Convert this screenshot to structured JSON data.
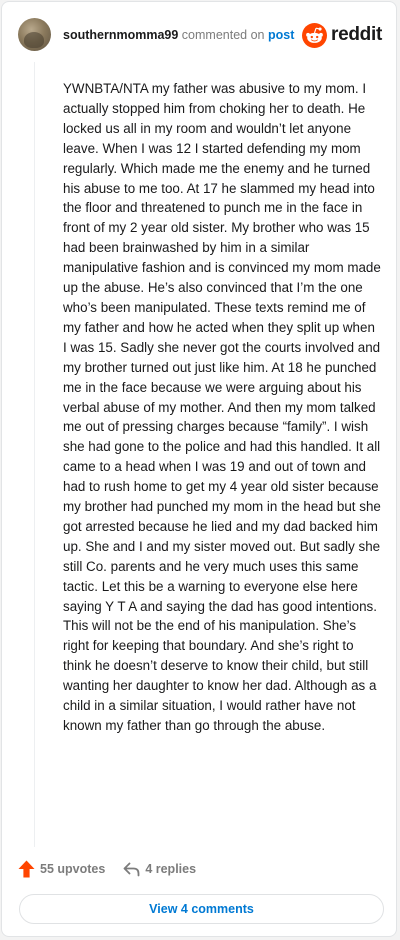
{
  "comment": {
    "username": "southernmomma99",
    "commented_on": "commented on",
    "post_link": "post",
    "avatar_icon": "user-avatar-photo",
    "body": "YWNBTA/NTA my father was abusive to my mom. I actually stopped him from choking her to death. He locked us all in my room and wouldn’t let anyone leave. When I was 12 I started defending my mom regularly. Which made me the enemy and he turned his abuse to me too. At 17 he slammed my head into the floor and threatened to punch me in the face in front of my 2 year old sister. My brother who was 15 had been brainwashed by him in a similar manipulative fashion and is convinced my mom made up the abuse. He’s also convinced that I’m the one who’s been manipulated. These texts remind me of my father and how he acted when they split up when I was 15. Sadly she never got the courts involved and my brother turned out just like him. At 18 he punched me in the face because we were arguing about his verbal abuse of my mother. And then my mom talked me out of pressing charges because “family”. I wish she had gone to the police and had this handled. It all came to a head when I was 19 and out of town and had to rush home to get my 4 year old sister because my brother had punched my mom in the head but she got arrested because he lied and my dad backed him up. She and I and my sister moved out. But sadly she still Co. parents and he very much uses this same tactic. Let this be a warning to everyone else here saying Y T A and saying the dad has good intentions. This will not be the end of his manipulation. She’s right for keeping that boundary. And she’s right to think he doesn’t deserve to know their child, but still wanting her daughter to know her dad. Although as a child in a similar situation, I would rather have not known my father than go through the abuse."
  },
  "brand": {
    "name": "reddit",
    "icon": "reddit-alien-icon",
    "color": "#ff4500"
  },
  "actions": {
    "upvotes_label": "55 upvotes",
    "upvote_icon": "upvote-arrow-icon",
    "upvote_color": "#ff4500",
    "replies_label": "4 replies",
    "reply_icon": "reply-arrow-icon"
  },
  "footer": {
    "view_comments_label": "View 4 comments"
  },
  "colors": {
    "link": "#0079d3",
    "text": "#1a1a1b",
    "muted": "#7c7c7c"
  }
}
